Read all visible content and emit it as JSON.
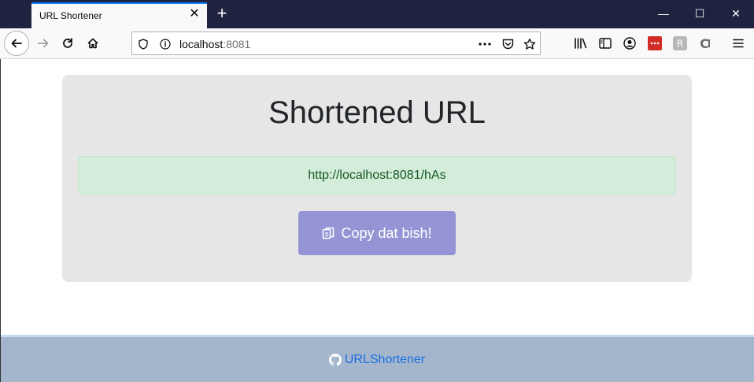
{
  "browser": {
    "tab_title": "URL Shortener",
    "tab_close": "✕",
    "new_tab": "+",
    "url_host": "localhost",
    "url_port": ":8081",
    "window_controls": {
      "minimize": "—",
      "maximize": "☐",
      "close": "✕"
    }
  },
  "page": {
    "heading": "Shortened URL",
    "short_url": "http://localhost:8081/hAs",
    "copy_button_label": "Copy dat bish!"
  },
  "footer": {
    "link_text": "URLShortener"
  },
  "colors": {
    "titlebar": "#202340",
    "card": "#e6e6e6",
    "result_bg": "#d4edda",
    "copy_button": "#9595d5",
    "footer": "#a3b6cc",
    "link": "#1b6fe0"
  }
}
